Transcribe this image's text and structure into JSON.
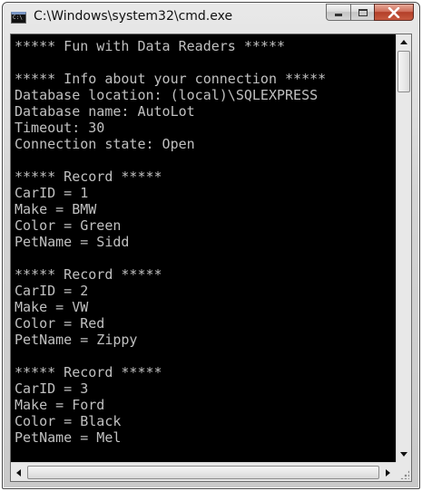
{
  "window": {
    "title": "C:\\Windows\\system32\\cmd.exe",
    "icon": "cmd-icon",
    "icon_text": "C:\\"
  },
  "caption_buttons": {
    "minimize_icon": "minimize-icon",
    "maximize_icon": "maximize-icon",
    "close_icon": "close-icon",
    "close_glyph": "X"
  },
  "console": {
    "background": "#000000",
    "foreground": "#c0c0c0",
    "lines": [
      "***** Fun with Data Readers *****",
      "",
      "***** Info about your connection *****",
      "Database location: (local)\\SQLEXPRESS",
      "Database name: AutoLot",
      "Timeout: 30",
      "Connection state: Open",
      "",
      "***** Record *****",
      "CarID = 1",
      "Make = BMW",
      "Color = Green",
      "PetName = Sidd",
      "",
      "***** Record *****",
      "CarID = 2",
      "Make = VW",
      "Color = Red",
      "PetName = Zippy",
      "",
      "***** Record *****",
      "CarID = 3",
      "Make = Ford",
      "Color = Black",
      "PetName = Mel"
    ]
  },
  "scrollbars": {
    "vertical": {
      "up_icon": "arrow-up-icon",
      "down_icon": "arrow-down-icon"
    },
    "horizontal": {
      "left_icon": "arrow-left-icon",
      "right_icon": "arrow-right-icon"
    }
  }
}
